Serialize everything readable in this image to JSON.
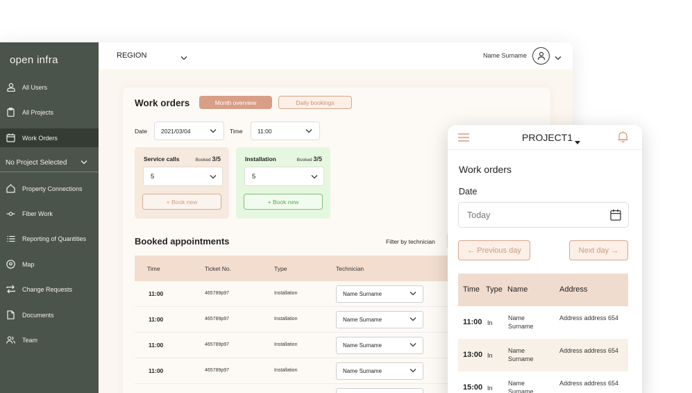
{
  "sidebar": {
    "logo": "open infra",
    "items": [
      {
        "label": "All Users",
        "icon": "user-icon"
      },
      {
        "label": "All Projects",
        "icon": "clipboard-icon"
      },
      {
        "label": "Work Orders",
        "icon": "calendar-icon",
        "active": true
      },
      {
        "label": "Property Connections",
        "icon": "house-icon"
      },
      {
        "label": "Fiber Work",
        "icon": "fiber-icon"
      },
      {
        "label": "Reporting of Quantities",
        "icon": "list-icon"
      },
      {
        "label": "Map",
        "icon": "map-pin-icon"
      },
      {
        "label": "Change Requests",
        "icon": "swap-icon"
      },
      {
        "label": "Documents",
        "icon": "document-icon"
      },
      {
        "label": "Team",
        "icon": "team-icon"
      }
    ],
    "project_select": "No Project Selected"
  },
  "topbar": {
    "region": "REGION",
    "user_name": "Name Surname"
  },
  "work_orders": {
    "title": "Work orders",
    "tab_month": "Month overview",
    "tab_daily": "Daily bookings",
    "date_label": "Date",
    "date_value": "2021/03/04",
    "time_label": "Time",
    "time_value": "11:00",
    "slots": [
      {
        "title": "Service calls",
        "booked_prefix": "Booked",
        "booked_value": "3/5",
        "select_value": "5",
        "button": "+ Book new"
      },
      {
        "title": "Installation",
        "booked_prefix": "Booked",
        "booked_value": "3/5",
        "select_value": "5",
        "button": "+ Book new"
      }
    ]
  },
  "appointments": {
    "title": "Booked appointments",
    "filter_label": "Filter by technician",
    "columns": [
      "Time",
      "Ticket  No.",
      "Type",
      "Technician"
    ],
    "rows": [
      {
        "time": "11:00",
        "ticket": "465789p97",
        "type": "Installation",
        "technician": "Name Surname"
      },
      {
        "time": "11:00",
        "ticket": "465789p97",
        "type": "Installation",
        "technician": "Name Surname"
      },
      {
        "time": "11:00",
        "ticket": "465789p97",
        "type": "Installation",
        "technician": "Name Surname"
      },
      {
        "time": "11:00",
        "ticket": "465789p97",
        "type": "Installation",
        "technician": "Name Surname"
      }
    ]
  },
  "mobile": {
    "project": "PROJECT1",
    "title": "Work orders",
    "date_label": "Date",
    "date_placeholder": "Today",
    "prev_button": "← Previous day",
    "next_button": "Next day →",
    "columns": [
      "Time",
      "Type",
      "Name",
      "Address"
    ],
    "rows": [
      {
        "time": "11:00",
        "type": "In",
        "name": "Name Surname",
        "address": "Address address 654"
      },
      {
        "time": "13:00",
        "type": "In",
        "name": "Name Surname",
        "address": "Address address 654"
      },
      {
        "time": "15:00",
        "type": "In",
        "name": "Name Surname",
        "address": "Address address 654"
      }
    ]
  },
  "colors": {
    "sidebar": "#4a544a",
    "sidebar_active": "#343c34",
    "accent": "#d99e86",
    "accent_light": "#fbefe6",
    "green": "#7cc374",
    "table_head": "#f2ddcf",
    "background": "#fbf6ef"
  }
}
